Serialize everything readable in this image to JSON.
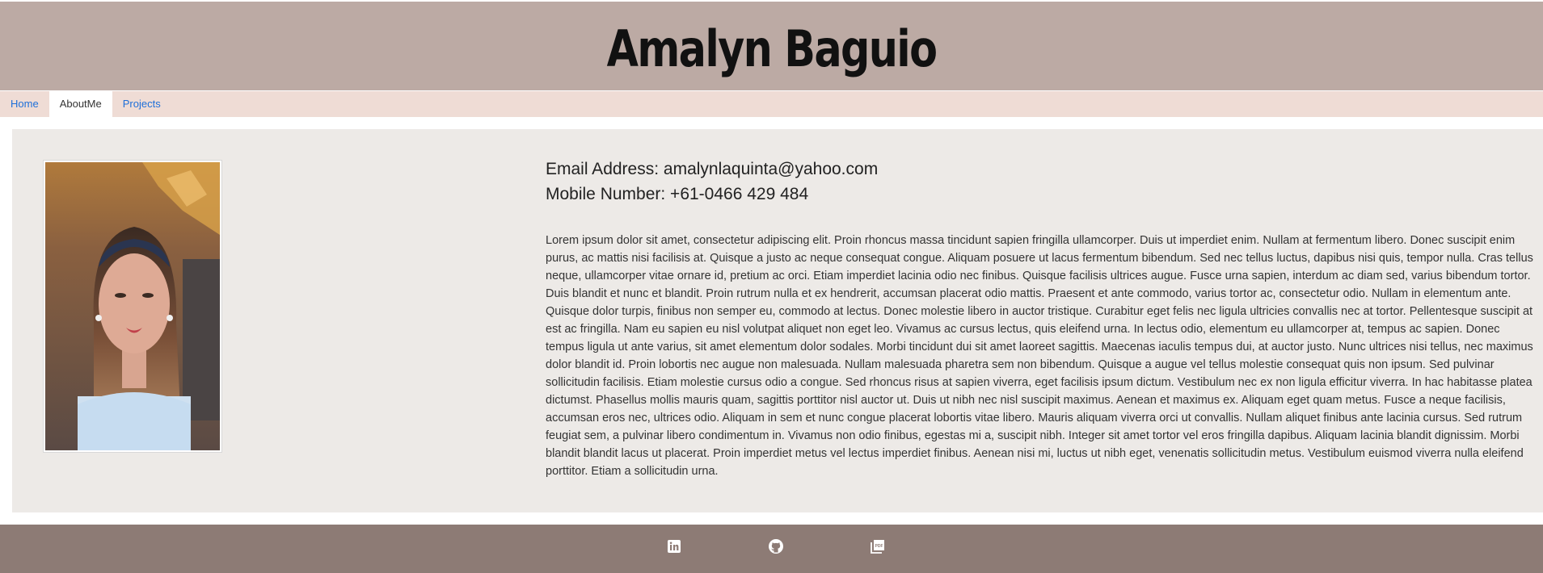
{
  "header": {
    "title": "Amalyn Baguio"
  },
  "nav": {
    "items": [
      {
        "label": "Home"
      },
      {
        "label": "AboutMe"
      },
      {
        "label": "Projects"
      }
    ]
  },
  "profile": {
    "email_line": "Email Address: amalynlaquinta@yahoo.com",
    "mobile_line": "Mobile Number: +61-0466 429 484",
    "bio": "Lorem ipsum dolor sit amet, consectetur adipiscing elit. Proin rhoncus massa tincidunt sapien fringilla ullamcorper. Duis ut imperdiet enim. Nullam at fermentum libero. Donec suscipit enim purus, ac mattis nisi facilisis at. Quisque a justo ac neque consequat congue. Aliquam posuere ut lacus fermentum bibendum. Sed nec tellus luctus, dapibus nisi quis, tempor nulla. Cras tellus neque, ullamcorper vitae ornare id, pretium ac orci. Etiam imperdiet lacinia odio nec finibus. Quisque facilisis ultrices augue. Fusce urna sapien, interdum ac diam sed, varius bibendum tortor. Duis blandit et nunc et blandit. Proin rutrum nulla et ex hendrerit, accumsan placerat odio mattis. Praesent et ante commodo, varius tortor ac, consectetur odio. Nullam in elementum ante. Quisque dolor turpis, finibus non semper eu, commodo at lectus. Donec molestie libero in auctor tristique. Curabitur eget felis nec ligula ultricies convallis nec at tortor. Pellentesque suscipit at est ac fringilla. Nam eu sapien eu nisl volutpat aliquet non eget leo. Vivamus ac cursus lectus, quis eleifend urna. In lectus odio, elementum eu ullamcorper at, tempus ac sapien. Donec tempus ligula ut ante varius, sit amet elementum dolor sodales. Morbi tincidunt dui sit amet laoreet sagittis. Maecenas iaculis tempus dui, at auctor justo. Nunc ultrices nisi tellus, nec maximus dolor blandit id. Proin lobortis nec augue non malesuada. Nullam malesuada pharetra sem non bibendum. Quisque a augue vel tellus molestie consequat quis non ipsum. Sed pulvinar sollicitudin facilisis. Etiam molestie cursus odio a congue. Sed rhoncus risus at sapien viverra, eget facilisis ipsum dictum. Vestibulum nec ex non ligula efficitur viverra. In hac habitasse platea dictumst. Phasellus mollis mauris quam, sagittis porttitor nisl auctor ut. Duis ut nibh nec nisl suscipit maximus. Aenean et maximus ex. Aliquam eget quam metus. Fusce a neque facilisis, accumsan eros nec, ultrices odio. Aliquam in sem et nunc congue placerat lobortis vitae libero. Mauris aliquam viverra orci ut convallis. Nullam aliquet finibus ante lacinia cursus. Sed rutrum feugiat sem, a pulvinar libero condimentum in. Vivamus non odio finibus, egestas mi a, suscipit nibh. Integer sit amet tortor vel eros fringilla dapibus. Aliquam lacinia blandit dignissim. Morbi blandit blandit lacus ut placerat. Proin imperdiet metus vel lectus imperdiet finibus. Aenean nisi mi, luctus ut nibh eget, venenatis sollicitudin metus. Vestibulum euismod viverra nulla eleifend porttitor. Etiam a sollicitudin urna."
  },
  "footer": {
    "icons": [
      "linkedin-icon",
      "github-icon",
      "pdf-icon"
    ]
  },
  "colors": {
    "header_bg": "#bcaaa4",
    "nav_bg": "#efdcd5",
    "content_bg": "#edeae7",
    "footer_bg": "#8d7b75",
    "link": "#1e6fd9"
  }
}
